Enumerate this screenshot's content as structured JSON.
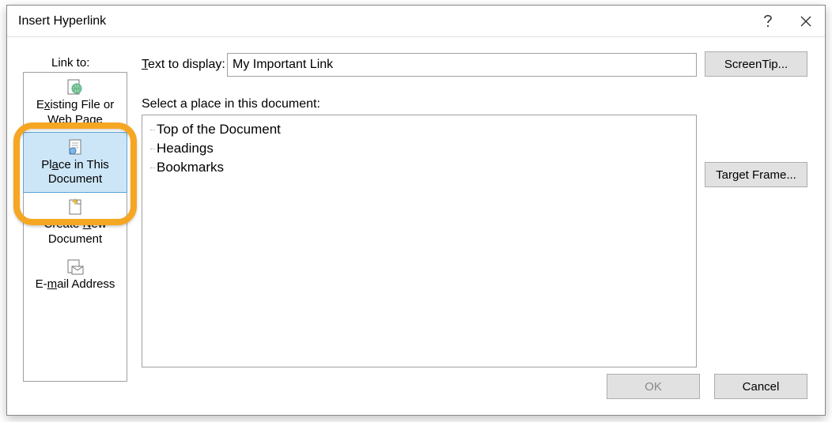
{
  "dialog": {
    "title": "Insert Hyperlink"
  },
  "linkto": {
    "label": "Link to:"
  },
  "sidebar": {
    "items": [
      {
        "label_pre": "E",
        "label_u": "x",
        "label_post": "isting File or Web Page"
      },
      {
        "label_pre": "Pl",
        "label_u": "a",
        "label_post": "ce in This Document"
      },
      {
        "label_pre": "Create ",
        "label_u": "N",
        "label_post": "ew Document"
      },
      {
        "label_pre": "E-",
        "label_u": "m",
        "label_post": "ail Address"
      }
    ]
  },
  "text_display": {
    "label_pre": "",
    "label_u": "T",
    "label_post": "ext to display:",
    "value": "My Important Link"
  },
  "buttons": {
    "screentip": "ScreenTip...",
    "target_frame": "Target Frame...",
    "ok": "OK",
    "cancel": "Cancel"
  },
  "place": {
    "label": "Select a place in this document:",
    "items": [
      "Top of the Document",
      "Headings",
      "Bookmarks"
    ]
  }
}
